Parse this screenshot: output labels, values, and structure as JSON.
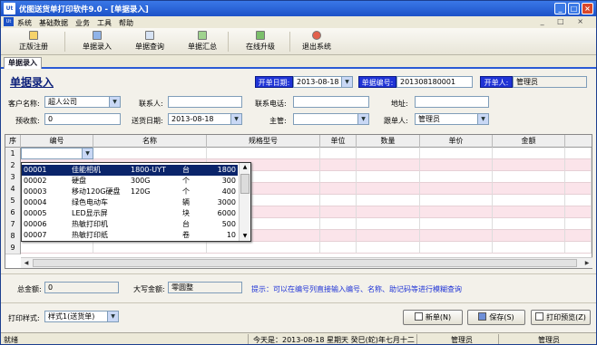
{
  "window": {
    "title": "优图送货单打印软件9.0 - [单据录入]",
    "logo": "Ut",
    "buttons": [
      "_",
      "□",
      "×"
    ]
  },
  "menu": {
    "items": [
      "系统",
      "基础数据",
      "业务",
      "工具",
      "帮助"
    ],
    "right_controls": "_ □ ×"
  },
  "toolbar": {
    "buttons": [
      "正版注册",
      "单据录入",
      "单据查询",
      "单据汇总",
      "在线升级",
      "退出系统"
    ]
  },
  "tabs": {
    "active": "单据录入"
  },
  "form": {
    "heading": "单据录入",
    "open_date_label": "开单日期:",
    "open_date": "2013-08-18",
    "doc_no_label": "单据编号:",
    "doc_no": "201308180001",
    "opener_label": "开单人:",
    "opener": "管理员",
    "customer_label": "客户名称:",
    "customer": "超人公司",
    "contact_label": "联系人:",
    "contact": "",
    "phone_label": "联系电话:",
    "phone": "",
    "address_label": "地址:",
    "address": "",
    "prepay_label": "预收款:",
    "prepay": "0",
    "ship_date_label": "送货日期:",
    "ship_date": "2013-08-18",
    "supervisor_label": "主管:",
    "supervisor": "",
    "follower_label": "跟单人:",
    "follower": "管理员"
  },
  "grid": {
    "columns": [
      "序",
      "编号",
      "名称",
      "规格型号",
      "单位",
      "数量",
      "单价",
      "金额"
    ],
    "row_numbers": [
      "1",
      "2",
      "3",
      "4",
      "5",
      "6",
      "7",
      "8",
      "9"
    ]
  },
  "product_dropdown": {
    "rows": [
      {
        "code": "00001",
        "name": "佳能相机",
        "spec": "1800-UYT",
        "unit": "台",
        "price": "1800"
      },
      {
        "code": "00002",
        "name": "硬盘",
        "spec": "300G",
        "unit": "个",
        "price": "300"
      },
      {
        "code": "00003",
        "name": "移动120G硬盘",
        "spec": "120G",
        "unit": "个",
        "price": "400"
      },
      {
        "code": "00004",
        "name": "绿色电动车",
        "spec": "",
        "unit": "辆",
        "price": "3000"
      },
      {
        "code": "00005",
        "name": "LED显示屏",
        "spec": "",
        "unit": "块",
        "price": "6000"
      },
      {
        "code": "00006",
        "name": "热敏打印机",
        "spec": "",
        "unit": "台",
        "price": "500"
      },
      {
        "code": "00007",
        "name": "热敏打印纸",
        "spec": "",
        "unit": "卷",
        "price": "10"
      }
    ]
  },
  "totals": {
    "total_label": "总金额:",
    "total": "0",
    "capital_label": "大写金额:",
    "capital": "零圆整",
    "hint": "提示：可以在编号列直接输入编号、名称、助记码等进行模糊查询"
  },
  "bottom": {
    "print_style_label": "打印样式:",
    "print_style": "样式1(送货单)",
    "new_btn": "新单(N)",
    "save_btn": "保存(S)",
    "preview_btn": "打印预览(Z)"
  },
  "status": {
    "ready": "就绪",
    "date": "今天是：2013-08-18  星期天  癸巳(蛇)年七月十二",
    "user1": "管理员",
    "user2": "管理员"
  },
  "colors": {
    "title_bar": "#1d52c7",
    "label_fill": "#1f33d6",
    "row_pink": "#fbe4ea",
    "selection": "#0a246a"
  }
}
